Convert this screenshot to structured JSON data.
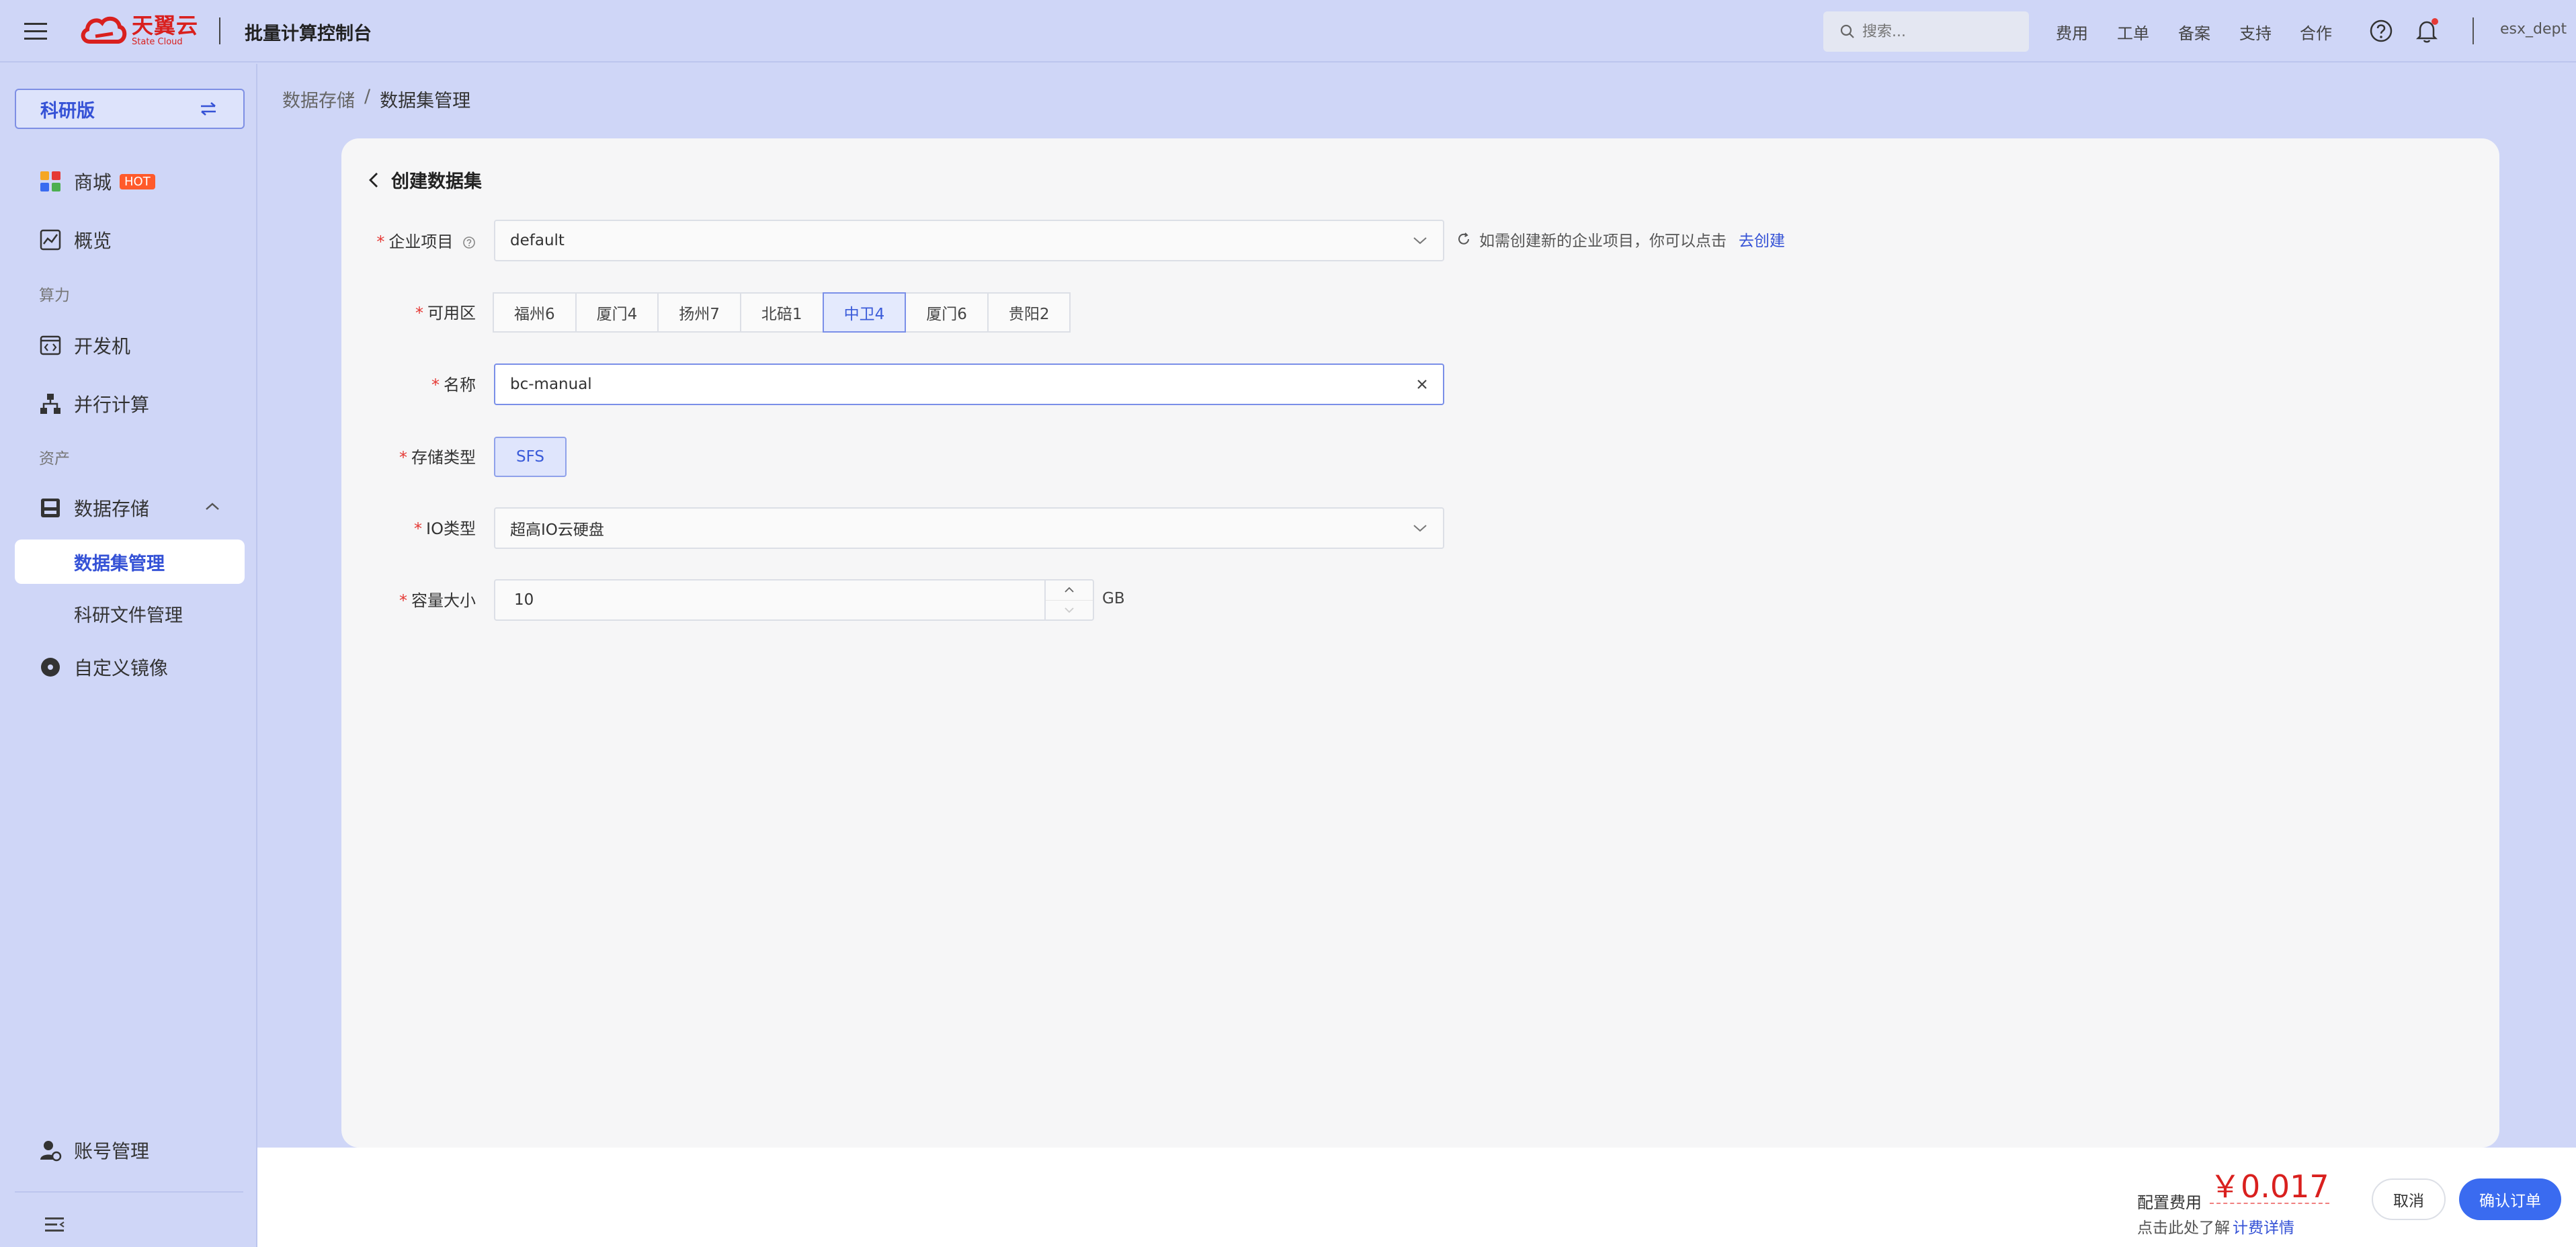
{
  "header": {
    "logo_main": "天翼云",
    "logo_sub": "State Cloud",
    "app_title": "批量计算控制台",
    "search_placeholder": "搜索...",
    "nav": [
      "费用",
      "工单",
      "备案",
      "支持",
      "合作"
    ],
    "user": "esx_dept"
  },
  "sidebar": {
    "edition": "科研版",
    "items": {
      "mall": "商城",
      "mall_badge": "HOT",
      "overview": "概览",
      "group_compute": "算力",
      "devbox": "开发机",
      "parallel": "并行计算",
      "group_assets": "资产",
      "storage": "数据存储",
      "dataset_mgmt": "数据集管理",
      "file_mgmt": "科研文件管理",
      "custom_image": "自定义镜像",
      "account": "账号管理"
    }
  },
  "breadcrumb": {
    "parent": "数据存储",
    "sep": "/",
    "current": "数据集管理"
  },
  "form": {
    "title": "创建数据集",
    "project_label": "企业项目",
    "project_value": "default",
    "project_hint": "如需创建新的企业项目，你可以点击",
    "project_hint_link": "去创建",
    "zone_label": "可用区",
    "zones": [
      "福州6",
      "厦门4",
      "扬州7",
      "北碚1",
      "中卫4",
      "厦门6",
      "贵阳2"
    ],
    "zone_selected": "中卫4",
    "name_label": "名称",
    "name_value": "bc-manual",
    "storage_type_label": "存储类型",
    "storage_type_value": "SFS",
    "io_type_label": "IO类型",
    "io_type_value": "超高IO云硬盘",
    "capacity_label": "容量大小",
    "capacity_value": "10",
    "capacity_unit": "GB"
  },
  "footer": {
    "fee_label": "配置费用",
    "fee_value": "￥0.017",
    "fee_note": "点击此处了解",
    "fee_link": "计费详情",
    "cancel": "取消",
    "confirm": "确认订单"
  },
  "colors": {
    "brand_red": "#d9201e",
    "primary_blue": "#3a6bf0",
    "background": "#cfd6f7"
  }
}
